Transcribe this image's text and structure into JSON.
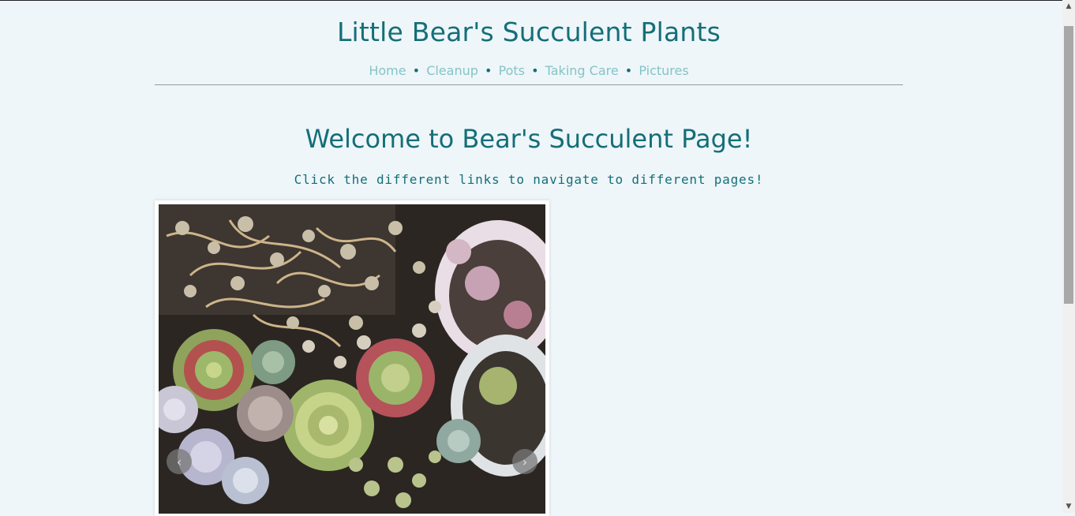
{
  "site": {
    "title": "Little Bear's Succulent Plants"
  },
  "nav": {
    "items": [
      {
        "label": "Home"
      },
      {
        "label": "Cleanup"
      },
      {
        "label": "Pots"
      },
      {
        "label": "Taking Care"
      },
      {
        "label": "Pictures"
      }
    ],
    "separator": "•"
  },
  "main": {
    "heading": "Welcome to Bear's Succulent Page!",
    "subtext": "Click the different links to navigate to different pages!"
  },
  "carousel": {
    "prev_icon": "chevron-left-icon",
    "next_icon": "chevron-right-icon",
    "prev_glyph": "‹",
    "next_glyph": "›"
  },
  "colors": {
    "background": "#eef6f9",
    "title": "#156e78",
    "nav_link": "#84c4c7"
  }
}
